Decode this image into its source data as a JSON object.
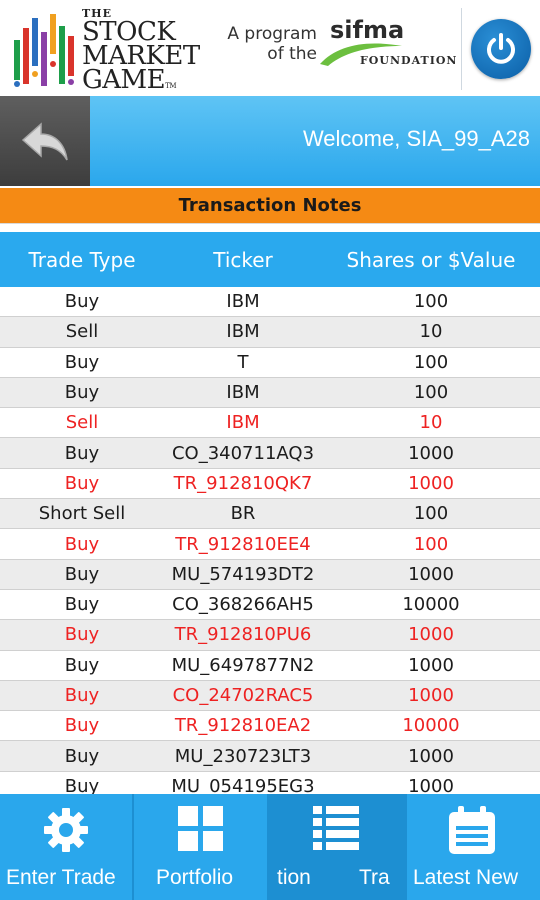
{
  "header": {
    "logo_the": "THE",
    "logo_line1": "STOCK",
    "logo_line2": "MARKET",
    "logo_line3": "GAME",
    "logo_tm": "TM",
    "program_line1": "A program",
    "program_line2": "of the",
    "sifma": "sifma",
    "foundation": "FOUNDATION",
    "power_icon": "power-icon"
  },
  "welcome": {
    "back_icon": "back-arrow-icon",
    "text": "Welcome, SIA_99_A28"
  },
  "section": {
    "title": "Transaction Notes"
  },
  "table": {
    "columns": [
      "Trade Type",
      "Ticker",
      "Shares or $Value"
    ],
    "rows": [
      {
        "type": "Buy",
        "ticker": "IBM",
        "value": "100",
        "red": false
      },
      {
        "type": "Sell",
        "ticker": "IBM",
        "value": "10",
        "red": false
      },
      {
        "type": "Buy",
        "ticker": "T",
        "value": "100",
        "red": false
      },
      {
        "type": "Buy",
        "ticker": "IBM",
        "value": "100",
        "red": false
      },
      {
        "type": "Sell",
        "ticker": "IBM",
        "value": "10",
        "red": true
      },
      {
        "type": "Buy",
        "ticker": "CO_340711AQ3",
        "value": "1000",
        "red": false
      },
      {
        "type": "Buy",
        "ticker": "TR_912810QK7",
        "value": "1000",
        "red": true
      },
      {
        "type": "Short Sell",
        "ticker": "BR",
        "value": "100",
        "red": false
      },
      {
        "type": "Buy",
        "ticker": "TR_912810EE4",
        "value": "100",
        "red": true
      },
      {
        "type": "Buy",
        "ticker": "MU_574193DT2",
        "value": "1000",
        "red": false
      },
      {
        "type": "Buy",
        "ticker": "CO_368266AH5",
        "value": "10000",
        "red": false
      },
      {
        "type": "Buy",
        "ticker": "TR_912810PU6",
        "value": "1000",
        "red": true
      },
      {
        "type": "Buy",
        "ticker": "MU_6497877N2",
        "value": "1000",
        "red": false
      },
      {
        "type": "Buy",
        "ticker": "CO_24702RAC5",
        "value": "1000",
        "red": true
      },
      {
        "type": "Buy",
        "ticker": "TR_912810EA2",
        "value": "10000",
        "red": true
      },
      {
        "type": "Buy",
        "ticker": "MU_230723LT3",
        "value": "1000",
        "red": false
      },
      {
        "type": "Buy",
        "ticker": "MU_054195EG3",
        "value": "1000",
        "red": false
      }
    ]
  },
  "nav": {
    "items": [
      {
        "label": "Enter Trade",
        "icon": "gear-icon"
      },
      {
        "label": "Portfolio",
        "icon": "grid-icon"
      },
      {
        "label": "tion",
        "icon": "list-icon"
      },
      {
        "label": "Tra",
        "icon": ""
      },
      {
        "label": "Latest New",
        "icon": "calendar-icon"
      }
    ]
  },
  "colors": {
    "accent_blue": "#2aa9ee",
    "orange": "#f58a14",
    "red_text": "#ee2222"
  }
}
